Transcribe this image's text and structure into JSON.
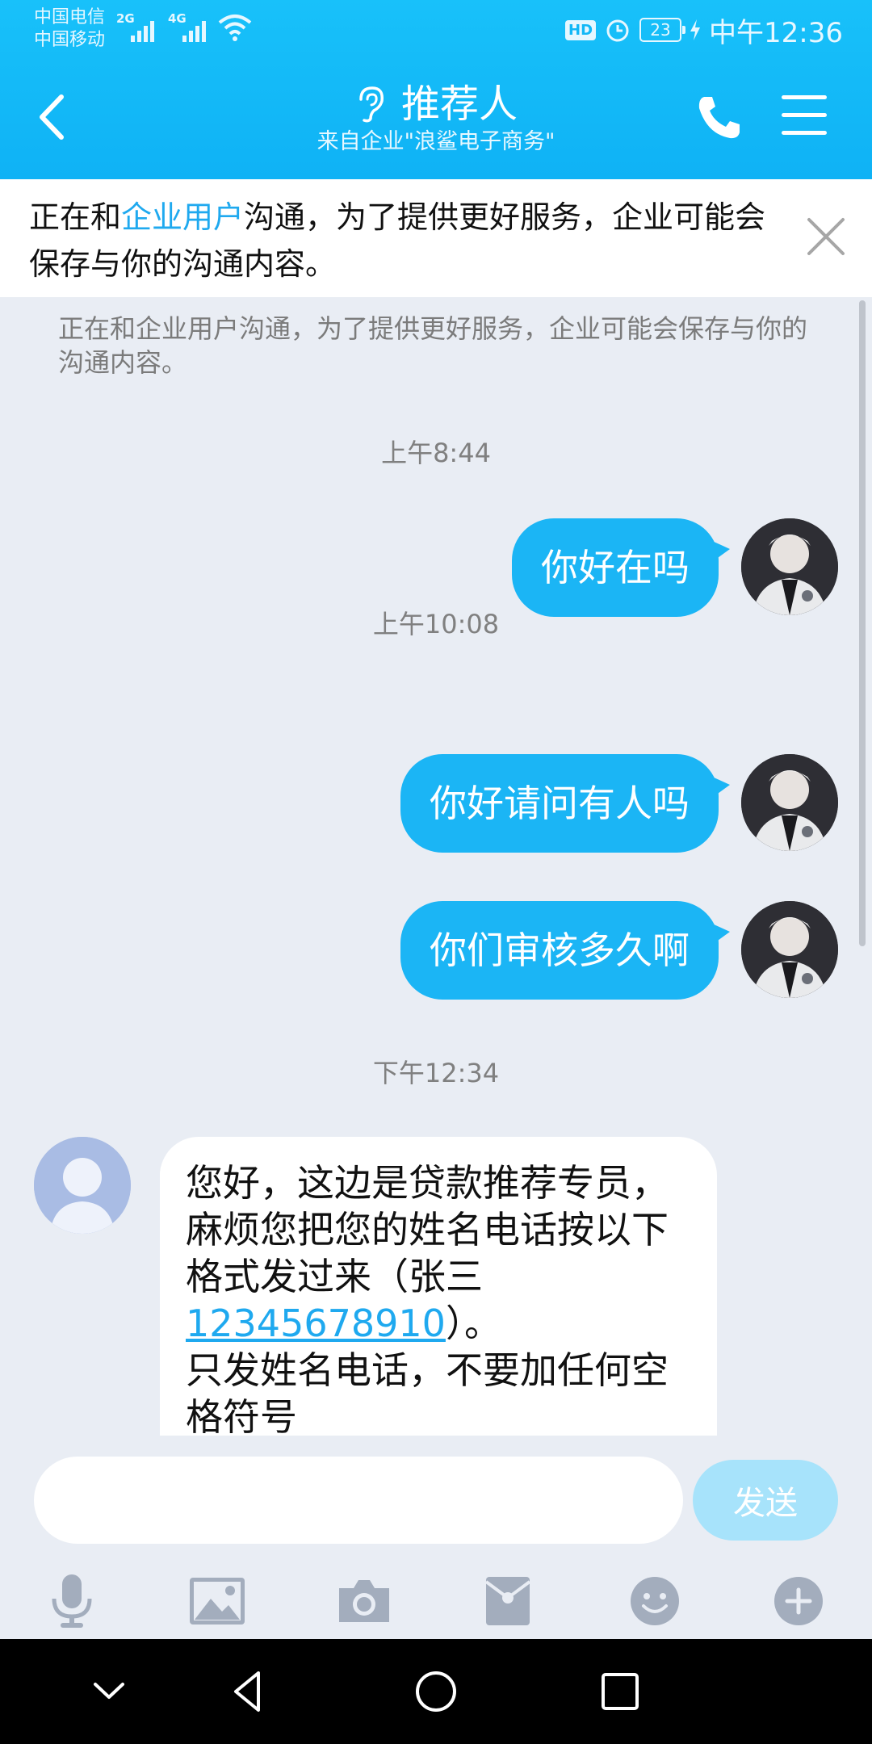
{
  "status_bar": {
    "carrier_1": "中国电信",
    "carrier_2": "中国移动",
    "signal_1_type": "2G",
    "signal_2_type": "4G",
    "hd_badge": "HD",
    "battery": "23",
    "time": "中午12:36"
  },
  "header": {
    "title": "推荐人",
    "subtitle": "来自企业\"浪鲨电子商务\""
  },
  "notice": {
    "text_before": "正在和",
    "highlight": "企业用户",
    "text_after": "沟通，为了提供更好服务，企业可能会保存与你的沟通内容。"
  },
  "chat": {
    "system_note": "正在和企业用户沟通，为了提供更好服务，企业可能会保存与你的沟通内容。",
    "times": [
      "上午8:44",
      "上午10:08",
      "下午12:34"
    ],
    "outgoing": [
      "你好在吗",
      "你好请问有人吗",
      "你们审核多久啊"
    ],
    "incoming": {
      "line1": "您好，这边是贷款推荐专员，麻烦您把您的姓名电话按以下格式发过来（张三",
      "phone": "12345678910",
      "line2": "）。",
      "line3": "只发姓名电话，不要加任何空格符号"
    }
  },
  "composer": {
    "placeholder": "",
    "send_label": "发送"
  },
  "toolbar": [
    "microphone-icon",
    "image-icon",
    "camera-icon",
    "red-packet-icon",
    "emoji-icon",
    "plus-icon"
  ],
  "colors": {
    "header": "#12b8f7",
    "bubble_out": "#1bb5f5",
    "link": "#1fa9ef",
    "background": "#e9edf4"
  }
}
